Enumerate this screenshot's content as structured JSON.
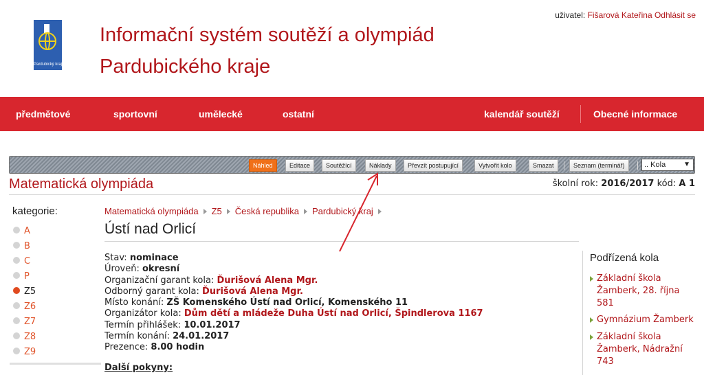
{
  "header": {
    "logo_text": "Pardubický kraj",
    "title_line1": "Informační systém soutěží a olympiád",
    "title_line2": "Pardubického kraje",
    "user_label": "uživatel:",
    "user_name": "Fišarová Kateřina",
    "logout": "Odhlásit se"
  },
  "nav": {
    "items": [
      "předmětové",
      "sportovní",
      "umělecké",
      "ostatní"
    ],
    "right_items": [
      "kalendář soutěží",
      "Obecné informace"
    ]
  },
  "toolbar": {
    "buttons": [
      "Náhled",
      "Editace",
      "Soutěžící",
      "Náklady",
      "Převzít postupující",
      "Vytvořit kolo",
      "Smazat",
      "Seznam (terminář)"
    ],
    "active": "Náhled",
    "select_value": ".. Kola"
  },
  "section": {
    "title": "Matematická olympiáda",
    "year_label": "školní rok:",
    "year": "2016/2017",
    "code_label": "kód:",
    "code": "A 1"
  },
  "sidebar": {
    "title": "kategorie:",
    "categories": [
      "A",
      "B",
      "C",
      "P",
      "Z5",
      "Z6",
      "Z7",
      "Z8",
      "Z9"
    ],
    "selected": "Z5"
  },
  "breadcrumb": [
    "Matematická olympiáda",
    "Z5",
    "Česká republika",
    "Pardubický kraj"
  ],
  "page_title": "Ústí nad Orlicí",
  "details": [
    {
      "label": "Stav:",
      "value": "nominace"
    },
    {
      "label": "Úroveň:",
      "value": "okresní"
    },
    {
      "label": "Organizační garant kola:",
      "value": "Ďurišová Alena Mgr."
    },
    {
      "label": "Odborný garant kola:",
      "value": "Ďurišová Alena Mgr."
    },
    {
      "label": "Místo konání:",
      "value": "ZŠ Komenského Ústí nad Orlicí, Komenského 11"
    },
    {
      "label": "Organizátor kola:",
      "value": "Dům dětí a mládeže Duha Ústí nad Orlicí, Špindlerova 1167"
    },
    {
      "label": "Termín přihlášek:",
      "value": "10.01.2017"
    },
    {
      "label": "Termín konání:",
      "value": "24.01.2017"
    },
    {
      "label": "Prezence:",
      "value": "8.00 hodin"
    }
  ],
  "further_label": "Další pokyny:",
  "subrounds": {
    "title": "Podřízená kola",
    "items": [
      "Základní škola Žamberk, 28. října 581",
      "Gymnázium Žamberk",
      "Základní škola Žamberk, Nádražní 743"
    ]
  },
  "colors": {
    "brand_red": "#d8262e",
    "link_red": "#b1171b",
    "active_orange": "#f07019"
  }
}
